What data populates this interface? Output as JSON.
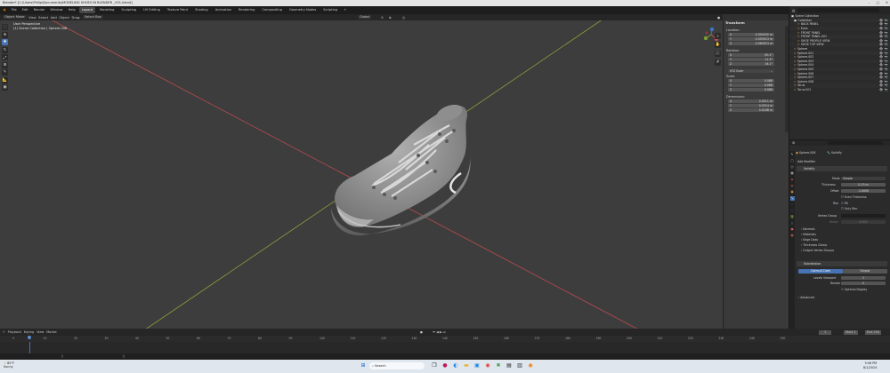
{
  "window": {
    "title": "Blender* [C:\\Users\\Philip\\Documents\\MODELING SHOES IN BLENDER _V01.blend]",
    "controls": [
      "–",
      "□",
      "✕"
    ]
  },
  "menu": {
    "items": [
      "File",
      "Edit",
      "Render",
      "Window",
      "Help"
    ],
    "workspaces": [
      "Layout",
      "Modeling",
      "Sculpting",
      "UV Editing",
      "Texture Paint",
      "Shading",
      "Animation",
      "Rendering",
      "Compositing",
      "Geometry Nodes",
      "Scripting"
    ],
    "active_workspace": "Layout",
    "right": {
      "scene": "Scene",
      "view_layer": "ViewLayer"
    }
  },
  "viewport_header": {
    "mode": "Object Mode",
    "menus": [
      "View",
      "Select",
      "Add",
      "Object"
    ],
    "drag": "Drag:",
    "drag_value": "Select Box",
    "orientation": "Global"
  },
  "viewport": {
    "line1": "User Perspective",
    "line2": "(1) Scene Collection | Sphere.008"
  },
  "tools": [
    "select-icon",
    "cursor-icon",
    "move-icon",
    "rotate-icon",
    "scale-icon",
    "transform-icon",
    "annotate-icon",
    "measure-icon",
    "add-cube-icon"
  ],
  "npanel": {
    "header": "Transform",
    "location_label": "Location:",
    "location": [
      {
        "axis": "X",
        "v": "0.094292 m"
      },
      {
        "axis": "Y",
        "v": "0.055913 m"
      },
      {
        "axis": "Z",
        "v": "0.065913 m"
      }
    ],
    "rotation_label": "Rotation:",
    "rotation": [
      {
        "axis": "X",
        "v": "90.1°"
      },
      {
        "axis": "Y",
        "v": "11.3°"
      },
      {
        "axis": "Z",
        "v": "16.1°"
      }
    ],
    "rotation_mode": "XYZ Euler",
    "scale_label": "Scale:",
    "scale": [
      {
        "axis": "X",
        "v": "0.088"
      },
      {
        "axis": "Y",
        "v": "0.088"
      },
      {
        "axis": "Z",
        "v": "0.088"
      }
    ],
    "dimensions_label": "Dimensions:",
    "dimensions": [
      {
        "axis": "X",
        "v": "0.0511 m"
      },
      {
        "axis": "Y",
        "v": "0.0314 m"
      },
      {
        "axis": "Z",
        "v": "0.0188 m"
      }
    ]
  },
  "outliner": {
    "header": "Scene Collection",
    "rows": [
      {
        "indent": 0,
        "name": "Collection",
        "type": "collection"
      },
      {
        "indent": 1,
        "name": "BACK PANEL",
        "type": "mesh"
      },
      {
        "indent": 1,
        "name": "Eyes",
        "type": "mesh"
      },
      {
        "indent": 1,
        "name": "FRONT PANEL",
        "type": "mesh"
      },
      {
        "indent": 1,
        "name": "FRONT PANEL.001",
        "type": "mesh"
      },
      {
        "indent": 1,
        "name": "SHOE PROFILE VIEW",
        "type": "mesh"
      },
      {
        "indent": 1,
        "name": "SHOE TOP VIEW",
        "type": "mesh"
      },
      {
        "indent": 0,
        "name": "Sphere",
        "type": "mesh"
      },
      {
        "indent": 0,
        "name": "Sphere.001",
        "type": "mesh"
      },
      {
        "indent": 0,
        "name": "Sphere.002",
        "type": "mesh"
      },
      {
        "indent": 0,
        "name": "Sphere.003",
        "type": "mesh"
      },
      {
        "indent": 0,
        "name": "Sphere.004",
        "type": "mesh"
      },
      {
        "indent": 0,
        "name": "Sphere.005",
        "type": "mesh"
      },
      {
        "indent": 0,
        "name": "Sphere.006",
        "type": "mesh"
      },
      {
        "indent": 0,
        "name": "Sphere.007",
        "type": "mesh"
      },
      {
        "indent": 0,
        "name": "Sphere.008",
        "type": "mesh"
      },
      {
        "indent": 0,
        "name": "Torus",
        "type": "mesh"
      },
      {
        "indent": 0,
        "name": "Torus.001",
        "type": "mesh"
      }
    ]
  },
  "properties": {
    "object": "Sphere.008",
    "modifier_tab": "Solidify",
    "add_modifier": "Add Modifier",
    "solidify": {
      "name": "Solidify",
      "mode_label": "Mode",
      "mode": "Simple",
      "thickness_label": "Thickness",
      "thickness": "0.13 m",
      "offset_label": "Offset",
      "offset": "-1.0000",
      "even": "Even Thickness",
      "rim_label": "Rim",
      "fill": "Fill",
      "only_rim": "Only Rim",
      "vgroup_label": "Vertex Group",
      "factor_label": "Factor",
      "factor": "0.000",
      "subpanels": [
        "Normals",
        "Materials",
        "Edge Data",
        "Thickness Clamp",
        "Output Vertex Groups"
      ]
    },
    "subsurf": {
      "name": "Subdivision",
      "tabs": [
        "Catmull-Clark",
        "Simple"
      ],
      "levels_label": "Levels Viewport",
      "levels": "1",
      "render_label": "Render",
      "render": "2",
      "optimal": "Optimal Display",
      "advanced": "Advanced"
    }
  },
  "timeline": {
    "menus": [
      "Playback",
      "Keying",
      "View",
      "Marker"
    ],
    "current_frame": "1",
    "start_label": "Start",
    "start": "1",
    "end_label": "End",
    "end": "250",
    "ticks": [
      "0",
      "10",
      "20",
      "30",
      "40",
      "50",
      "60",
      "70",
      "80",
      "90",
      "100",
      "110",
      "120",
      "130",
      "140",
      "150",
      "160",
      "170",
      "180",
      "190",
      "200",
      "210",
      "220",
      "230",
      "240",
      "250"
    ]
  },
  "taskbar": {
    "search": "Search",
    "weather_temp": "85°F",
    "weather_desc": "Sunny",
    "time": "5:06 PM",
    "date": "8/1/2024"
  }
}
